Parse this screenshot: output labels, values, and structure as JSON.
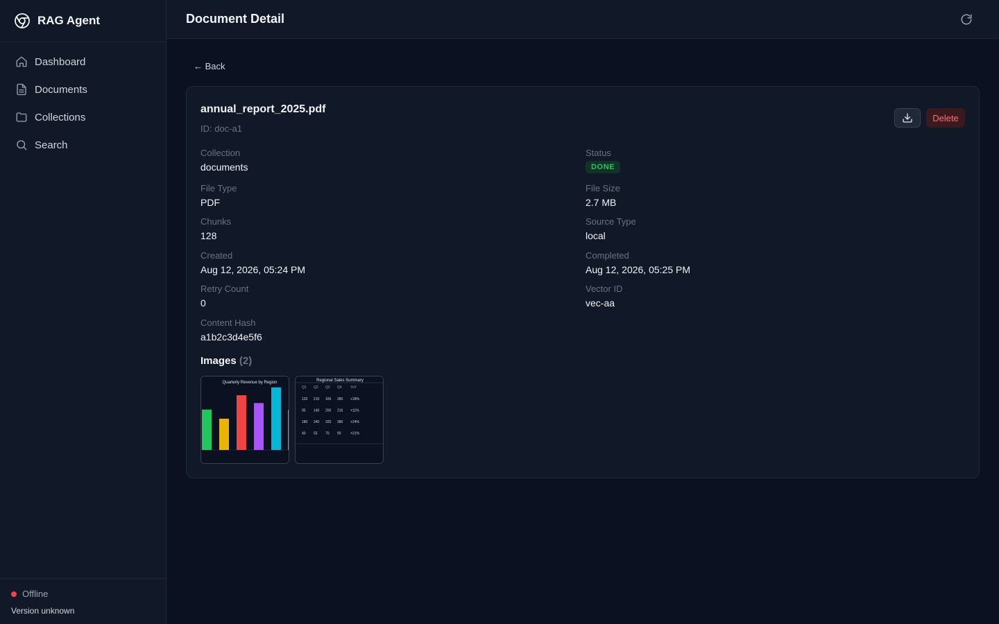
{
  "app": {
    "name": "RAG Agent"
  },
  "sidebar": {
    "items": [
      {
        "label": "Dashboard",
        "icon": "home-icon"
      },
      {
        "label": "Documents",
        "icon": "document-icon"
      },
      {
        "label": "Collections",
        "icon": "folder-icon"
      },
      {
        "label": "Search",
        "icon": "search-icon"
      }
    ],
    "status": "Offline",
    "status_color": "#ef4444",
    "version": "Version unknown"
  },
  "header": {
    "title": "Document Detail",
    "refresh_icon": "refresh-icon"
  },
  "back": {
    "label": "← Back"
  },
  "document": {
    "name": "annual_report_2025.pdf",
    "id": "ID: doc-a1",
    "delete_label": "Delete",
    "download_icon": "download-icon",
    "fields": {
      "collection": {
        "label": "Collection",
        "value": "documents"
      },
      "status": {
        "label": "Status",
        "value": "DONE",
        "color": "#22c55e"
      },
      "file_type": {
        "label": "File Type",
        "value": "PDF"
      },
      "file_size": {
        "label": "File Size",
        "value": "2.7 MB"
      },
      "chunks": {
        "label": "Chunks",
        "value": "128"
      },
      "source_type": {
        "label": "Source Type",
        "value": "local"
      },
      "created": {
        "label": "Created",
        "value": "Aug 12, 2026, 05:24 PM"
      },
      "completed": {
        "label": "Completed",
        "value": "Aug 12, 2026, 05:25 PM"
      },
      "retry_count": {
        "label": "Retry Count",
        "value": "0"
      },
      "vector_id": {
        "label": "Vector ID",
        "value": "vec-aa"
      },
      "content_hash": {
        "label": "Content Hash",
        "value": "a1b2c3d4e5f6"
      }
    },
    "images": {
      "title": "Images",
      "count": "(2)",
      "thumb1": {
        "title": "Quarterly Revenue by Region",
        "bar_colors": [
          "#22c55e",
          "#eab308",
          "#ef4444",
          "#a855f7",
          "#06b6d4"
        ],
        "bar_values": [
          0.62,
          0.48,
          0.84,
          0.72,
          0.96
        ]
      },
      "thumb2": {
        "title": "Regional Sales Summary",
        "header": [
          "Q1",
          "Q2",
          "Q3",
          "Q4",
          "YoY"
        ],
        "rows": [
          [
            "120",
            "210",
            "165",
            "280",
            "+18%"
          ],
          [
            "95",
            "140",
            "200",
            "216",
            "+11%"
          ],
          [
            "180",
            "240",
            "320",
            "380",
            "+24%"
          ],
          [
            "40",
            "55",
            "70",
            "90",
            "+31%"
          ]
        ]
      }
    }
  }
}
